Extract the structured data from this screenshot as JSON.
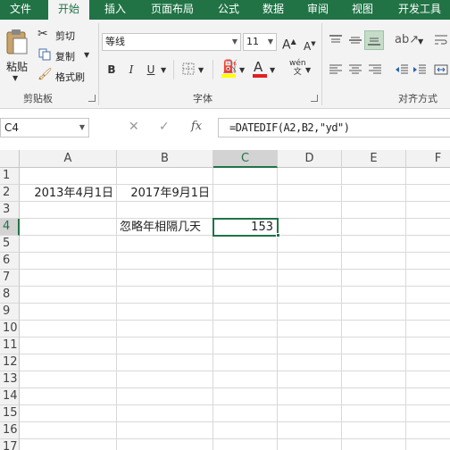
{
  "tabs": [
    "文件",
    "开始",
    "插入",
    "页面布局",
    "公式",
    "数据",
    "审阅",
    "视图",
    "开发工具"
  ],
  "active_tab": "开始",
  "clipboard": {
    "paste_label": "粘贴",
    "cut_label": "剪切",
    "copy_label": "复制",
    "format_painter_label": "格式刷",
    "group_label": "剪贴板"
  },
  "font": {
    "font_name": "等线",
    "font_size": "11",
    "bold": "B",
    "italic": "I",
    "underline": "U",
    "grow": "A",
    "shrink": "A",
    "font_color_glyph": "A",
    "group_label": "字体"
  },
  "alignment": {
    "group_label": "对齐方式"
  },
  "formula_bar": {
    "name_box": "C4",
    "fx": "fx",
    "formula": "=DATEDIF(A2,B2,\"yd\")"
  },
  "sheet": {
    "columns": [
      "A",
      "B",
      "C",
      "D",
      "E",
      "F"
    ],
    "selected_column": "C",
    "rows": [
      "1",
      "2",
      "3",
      "4",
      "5",
      "6",
      "7",
      "8",
      "9",
      "10",
      "11",
      "12",
      "13",
      "14",
      "15",
      "16",
      "17"
    ],
    "selected_row": "4",
    "cells": {
      "A2": "2013年4月1日",
      "B2": "2017年9月1日",
      "B4": "忽略年相隔几天",
      "C4": "153"
    }
  },
  "colors": {
    "accent": "#217346",
    "ribbon_bg": "#f3f3f3"
  }
}
